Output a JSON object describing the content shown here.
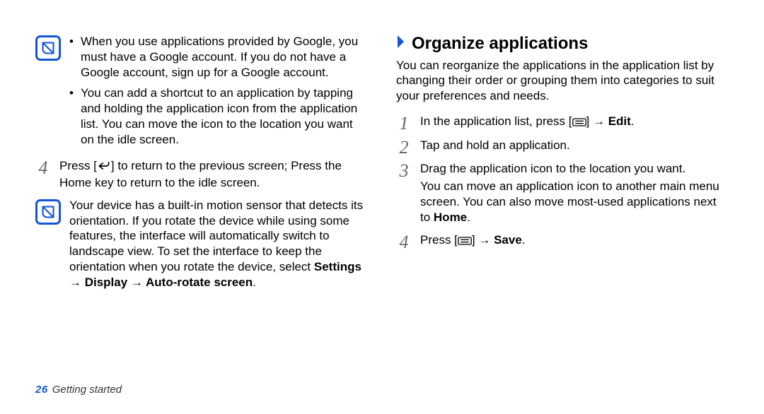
{
  "left": {
    "note1_bullets": [
      "When you use applications provided by Google, you must have a Google account. If you do not have a Google account, sign up for a Google account.",
      "You can add a shortcut to an application by tapping and holding the application icon from the application list. You can move the icon to the location you want on the idle screen."
    ],
    "step4_text": "] to return to the previous screen; Press the Home key to return to the idle screen.",
    "step4_prefix": "Press [",
    "note2_text_pre": "Your device has a built-in motion sensor that detects its orientation. If you rotate the device while using some features, the interface will automatically switch to landscape view. To set the interface to keep the orientation when you rotate the device, select ",
    "note2_bold": "Settings → Display → Auto-rotate screen",
    "note2_suffix": "."
  },
  "right": {
    "heading": "Organize applications",
    "intro": "You can reorganize the applications in the application list by changing their order or grouping them into categories to suit your preferences and needs.",
    "steps": {
      "s1_pre": "In the application list, press [",
      "s1_mid": "] → ",
      "s1_bold": "Edit",
      "s1_suffix": ".",
      "s2": "Tap and hold an application.",
      "s3_line1": "Drag the application icon to the location you want.",
      "s3_line2_pre": "You can move an application icon to another main menu screen. You can also move most-used applications next to ",
      "s3_line2_bold": "Home",
      "s3_line2_suffix": ".",
      "s4_pre": "Press [",
      "s4_mid": "] → ",
      "s4_bold": "Save",
      "s4_suffix": "."
    }
  },
  "footer": {
    "page": "26",
    "section": "Getting started"
  },
  "step_numbers": {
    "n1": "1",
    "n2": "2",
    "n3": "3",
    "n4": "4"
  },
  "icons": {
    "note": "note-icon",
    "back": "back-key-icon",
    "menu": "menu-key-icon",
    "chevron": "chevron-right-icon"
  }
}
